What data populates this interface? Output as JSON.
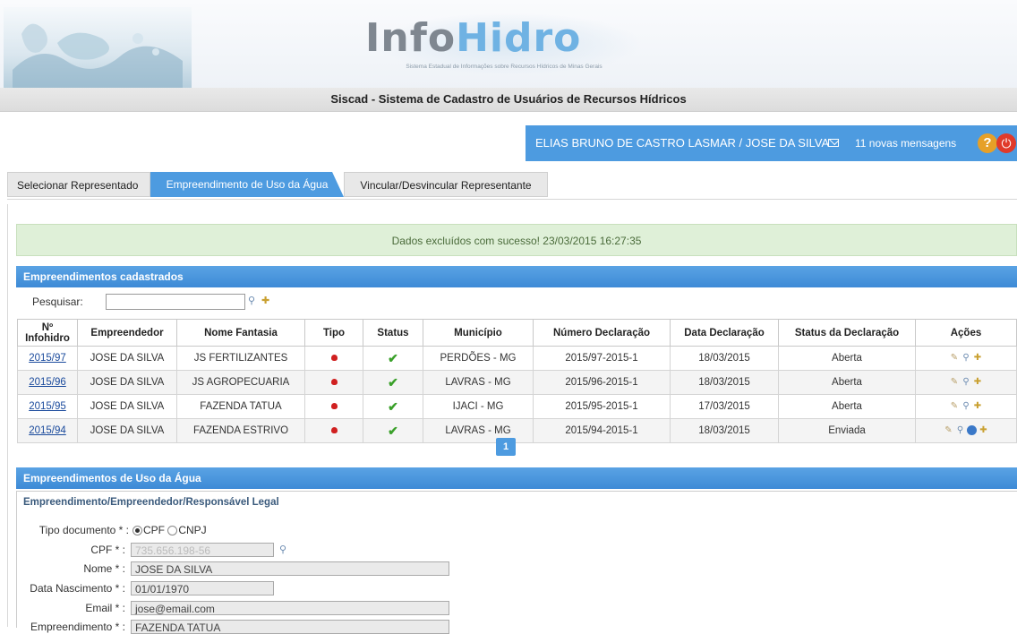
{
  "header": {
    "logo_info": "Info",
    "logo_hidro": "Hidro",
    "logo_subtitle": "Sistema Estadual de Informações sobre Recursos Hídricos de Minas Gerais",
    "system_title": "Siscad - Sistema de Cadastro de Usuários de Recursos Hídricos"
  },
  "userbar": {
    "user": "ELIAS BRUNO DE CASTRO LASMAR  /  JOSE DA SILVA",
    "messages": "11 novas mensagens",
    "help": "?",
    "power": "⏻"
  },
  "tabs": [
    {
      "label": "Selecionar Representado"
    },
    {
      "label": "Empreendimento de Uso da Água"
    },
    {
      "label": "Vincular/Desvincular Representante"
    }
  ],
  "alert": "Dados excluídos com sucesso! 23/03/2015 16:27:35",
  "list": {
    "title": "Empreendimentos cadastrados",
    "search_label": "Pesquisar:",
    "columns": [
      "Nº Infohidro",
      "Empreendedor",
      "Nome Fantasia",
      "Tipo",
      "Status",
      "Município",
      "Número Declaração",
      "Data Declaração",
      "Status da Declaração",
      "Ações"
    ],
    "rows": [
      {
        "id": "2015/97",
        "empreendedor": "JOSE DA SILVA",
        "fantasia": "JS FERTILIZANTES",
        "municipio": "PERDÕES - MG",
        "numero": "2015/97-2015-1",
        "data": "18/03/2015",
        "status_decl": "Aberta"
      },
      {
        "id": "2015/96",
        "empreendedor": "JOSE DA SILVA",
        "fantasia": "JS AGROPECUARIA",
        "municipio": "LAVRAS - MG",
        "numero": "2015/96-2015-1",
        "data": "18/03/2015",
        "status_decl": "Aberta"
      },
      {
        "id": "2015/95",
        "empreendedor": "JOSE DA SILVA",
        "fantasia": "FAZENDA TATUA",
        "municipio": "IJACI - MG",
        "numero": "2015/95-2015-1",
        "data": "17/03/2015",
        "status_decl": "Aberta"
      },
      {
        "id": "2015/94",
        "empreendedor": "JOSE DA SILVA",
        "fantasia": "FAZENDA ESTRIVO",
        "municipio": "LAVRAS - MG",
        "numero": "2015/94-2015-1",
        "data": "18/03/2015",
        "status_decl": "Enviada"
      }
    ],
    "page": "1"
  },
  "form": {
    "title": "Empreendimentos de Uso da Água",
    "subtitle": "Empreendimento/Empreendedor/Responsável Legal",
    "tipo_label": "Tipo documento * :",
    "opt_cpf": "CPF",
    "opt_cnpj": "CNPJ",
    "cpf_label": "CPF * :",
    "cpf_value": "735.656.198-56",
    "nome_label": "Nome * :",
    "nome_value": "JOSE DA SILVA",
    "nasc_label": "Data Nascimento * :",
    "nasc_value": "01/01/1970",
    "email_label": "Email * :",
    "email_value": "jose@email.com",
    "fantasia_label": "Empreendimento * :",
    "fantasia_value": "FAZENDA TATUA"
  }
}
